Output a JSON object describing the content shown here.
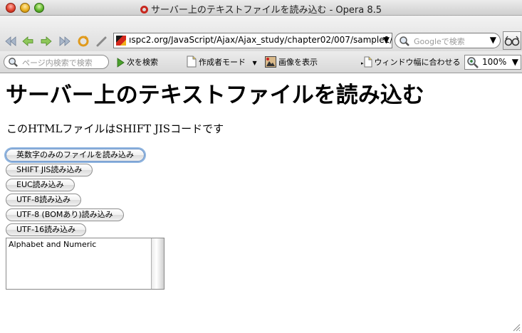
{
  "window": {
    "title": "サーバー上のテキストファイルを読み込む - Opera 8.5"
  },
  "toolbar": {
    "address_url": "ıspc2.org/JavaScript/Ajax/Ajax_study/chapter02/007/sample1/",
    "search_placeholder": "Googleで検索",
    "find_placeholder": "ページ内検索で検索",
    "find_next_label": "次を検索",
    "author_mode_label": "作成者モード",
    "show_images_label": "画像を表示",
    "fit_width_label": "ウィンドウ幅に合わせる",
    "zoom_value": "100%",
    "icons": [
      "rewind-icon",
      "back-icon",
      "forward-icon",
      "fast-forward-icon",
      "reload-icon",
      "edit-icon",
      "search-icon",
      "glasses-icon",
      "zoom-icon"
    ]
  },
  "page": {
    "heading": "サーバー上のテキストファイルを読み込む",
    "description": "このHTMLファイルはSHIFT JISコードです",
    "buttons": [
      "英数字のみのファイルを読み込み",
      "SHIFT JIS読み込み",
      "EUC読み込み",
      "UTF-8読み込み",
      "UTF-8 (BOMあり)読み込み",
      "UTF-16読み込み"
    ],
    "textarea_value": "Alphabet and Numeric"
  },
  "colors": {
    "focus_ring": "#8eb4df",
    "opera_red": "#c8281f"
  }
}
